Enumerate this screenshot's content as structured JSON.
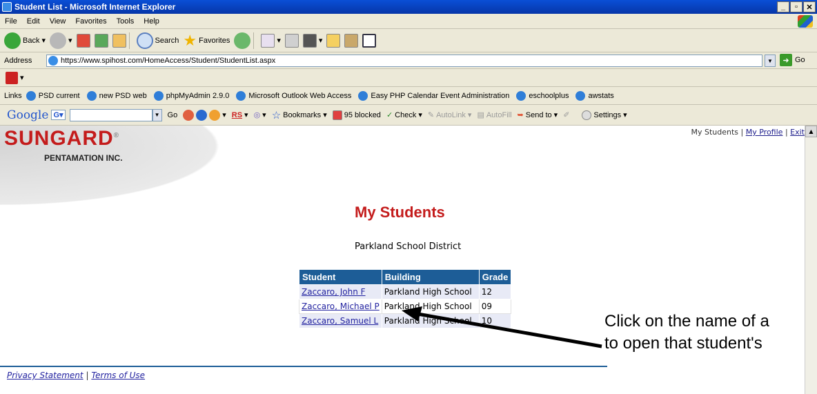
{
  "window": {
    "title": "Student List - Microsoft Internet Explorer"
  },
  "menu": [
    "File",
    "Edit",
    "View",
    "Favorites",
    "Tools",
    "Help"
  ],
  "toolbar": {
    "back": "Back",
    "search": "Search",
    "favorites": "Favorites"
  },
  "address": {
    "label": "Address",
    "url": "https://www.spihost.com/HomeAccess/Student/StudentList.aspx",
    "go": "Go"
  },
  "links": {
    "label": "Links",
    "items": [
      "PSD current",
      "new PSD web",
      "phpMyAdmin 2.9.0",
      "Microsoft Outlook Web Access",
      "Easy PHP Calendar Event Administration",
      "eschoolplus",
      "awstats"
    ]
  },
  "google": {
    "logo": "Google",
    "g": "G",
    "go": "Go",
    "rs": "RS",
    "bookmarks": "Bookmarks",
    "blocked": "95 blocked",
    "check": "Check",
    "autolink": "AutoLink",
    "autofill": "AutoFill",
    "sendto": "Send to",
    "settings": "Settings"
  },
  "page": {
    "brand": "SUNGARD",
    "brand_sub": "PENTAMATION INC.",
    "toplinks": {
      "my_students": "My Students",
      "sep": "|",
      "my_profile": "My Profile",
      "exit": "Exit"
    },
    "title": "My Students",
    "district": "Parkland School District",
    "table": {
      "headers": [
        "Student",
        "Building",
        "Grade"
      ],
      "rows": [
        {
          "student": "Zaccaro, John F",
          "building": "Parkland High School",
          "grade": "12"
        },
        {
          "student": "Zaccaro, Michael P",
          "building": "Parkland High School",
          "grade": "09"
        },
        {
          "student": "Zaccaro, Samuel L",
          "building": "Parkland High School",
          "grade": "10"
        }
      ]
    },
    "footer": {
      "privacy": "Privacy Statement",
      "sep": "|",
      "terms": "Terms of Use"
    }
  },
  "callout": {
    "line1": "Click on the name of a",
    "line2": "to open that student's"
  }
}
